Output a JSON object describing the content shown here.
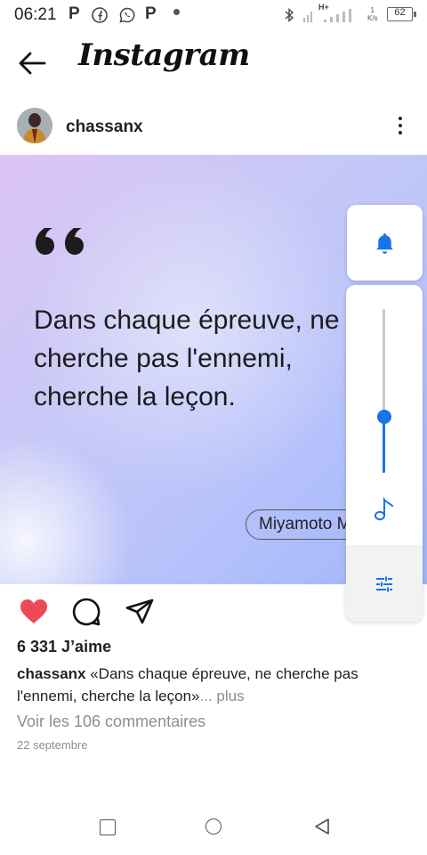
{
  "status_bar": {
    "time": "06:21",
    "network": "H+",
    "speed_value": "1",
    "speed_unit": "K/s",
    "battery": "62"
  },
  "header": {
    "brand": "Instagram"
  },
  "post": {
    "username": "chassanx",
    "quote_lines": [
      "Dans chaque épreuve, ne",
      "cherche pas l'ennemi,",
      "cherche la leçon."
    ],
    "author": "Miyamoto Musashi",
    "likes": "6 331 J’aime",
    "caption_user": "chassanx",
    "caption_text": " «Dans chaque épreuve, ne cherche pas l'ennemi, cherche la leçon»",
    "caption_more": "... plus",
    "comments_link": "Voir les 106 commentaires",
    "date": "22 septembre"
  },
  "volume_overlay": {
    "level_fraction": 0.35,
    "accent_color": "#1a73e8"
  },
  "icons": {
    "back": "arrow-left-icon",
    "menu": "more-vertical-icon",
    "like": "heart-icon",
    "comment": "comment-icon",
    "share": "send-icon",
    "bell": "bell-icon",
    "note": "music-note-icon",
    "settings": "sliders-icon"
  },
  "colors": {
    "like_red": "#ed4956",
    "muted_text": "#8e8e8e"
  }
}
